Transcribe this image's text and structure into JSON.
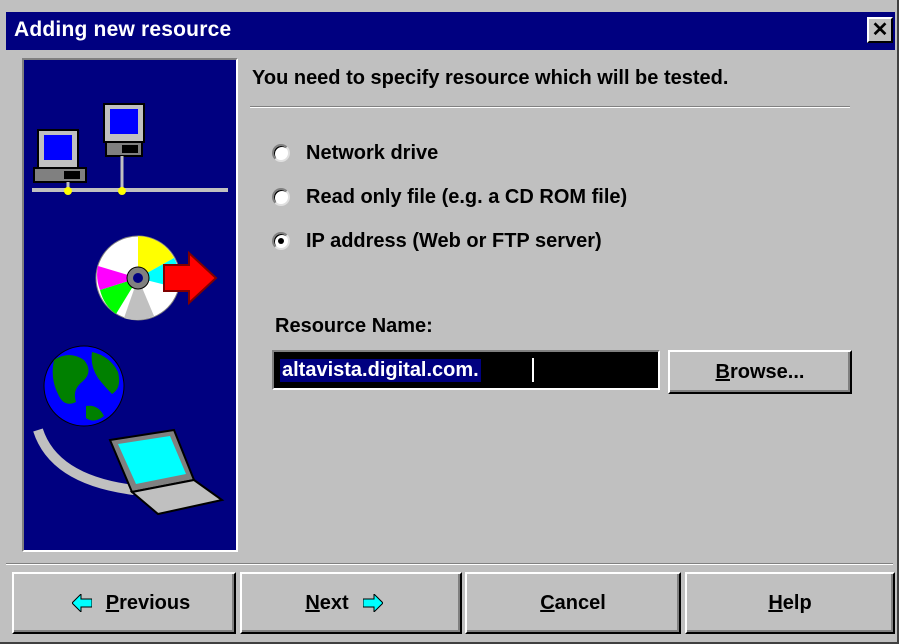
{
  "window": {
    "title": "Adding new resource"
  },
  "instruction": "You need to specify resource which will be tested.",
  "resource_type": {
    "options": [
      {
        "label": "Network drive",
        "selected": false
      },
      {
        "label": "Read only file (e.g. a CD ROM file)",
        "selected": false
      },
      {
        "label": "IP address (Web or FTP server)",
        "selected": true
      }
    ]
  },
  "resource_name": {
    "label": "Resource Name:",
    "value": "altavista.digital.com."
  },
  "buttons": {
    "browse": {
      "mnemonic": "B",
      "rest": "rowse..."
    },
    "previous": {
      "mnemonic": "P",
      "rest": "revious"
    },
    "next": {
      "mnemonic": "N",
      "rest": "ext"
    },
    "cancel": {
      "mnemonic": "C",
      "rest": "ancel"
    },
    "help": {
      "mnemonic": "H",
      "rest": "elp"
    }
  },
  "icons": {
    "arrow_color": "#00ffff",
    "title_color": "#000080"
  }
}
